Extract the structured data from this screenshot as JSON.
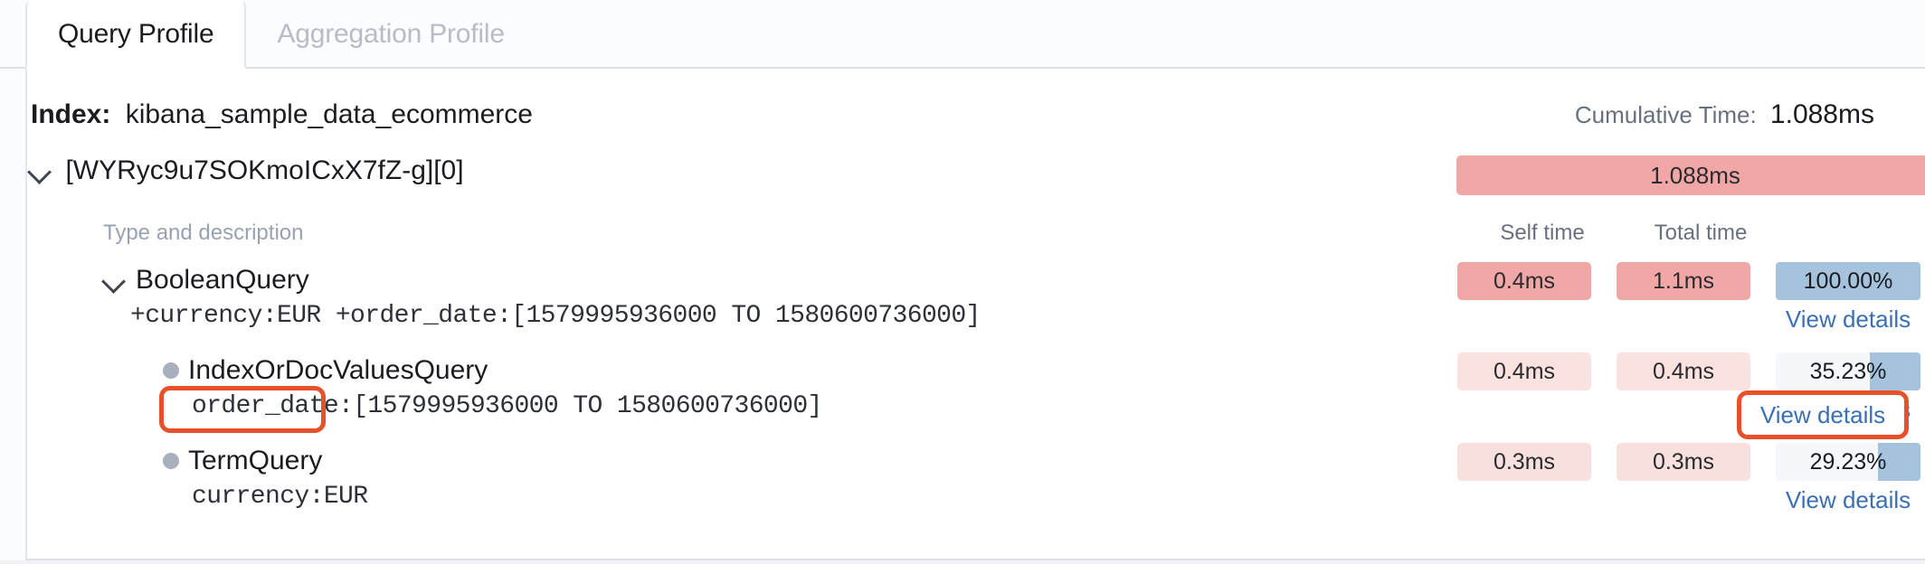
{
  "tabs": [
    {
      "label": "Query Profile",
      "active": true
    },
    {
      "label": "Aggregation Profile",
      "active": false
    }
  ],
  "header": {
    "index_label": "Index:",
    "index_value": "kibana_sample_data_ecommerce",
    "cumulative_label": "Cumulative Time:",
    "cumulative_value": "1.088ms"
  },
  "shard": {
    "id": "[WYRyc9u7SOKmoICxX7fZ-g][0]",
    "time": "1.088ms",
    "expanded": true
  },
  "columns": {
    "type_description": "Type and description",
    "self_time": "Self time",
    "total_time": "Total time"
  },
  "view_details_label": "View details",
  "rows": [
    {
      "name": "BooleanQuery",
      "description": "+currency:EUR +order_date:[1579995936000 TO 1580600736000]",
      "self_time": "0.4ms",
      "total_time": "1.1ms",
      "percent_label": "100.00%",
      "percent_value": 100.0,
      "self_color": "#f2a7a7",
      "total_color": "#f2a7a7",
      "marker": "chevron",
      "view_details": "View details"
    },
    {
      "name": "IndexOrDocValuesQuery",
      "description": "order_date:[1579995936000 TO 1580600736000]",
      "self_time": "0.4ms",
      "total_time": "0.4ms",
      "percent_label": "35.23%",
      "percent_value": 35.23,
      "self_color": "#fae2e0",
      "total_color": "#fae2e0",
      "marker": "bullet",
      "view_details": "View details"
    },
    {
      "name": "TermQuery",
      "description": "currency:EUR",
      "self_time": "0.3ms",
      "total_time": "0.3ms",
      "percent_label": "29.23%",
      "percent_value": 29.23,
      "self_color": "#f7e0dd",
      "total_color": "#f7e0dd",
      "marker": "bullet",
      "view_details": "View details"
    }
  ],
  "annotations": {
    "highlight_color": "#e8502a",
    "order_date_token": "order_date",
    "view_details_token": "View details"
  },
  "colors": {
    "bar_strong_pink": "#f2a7a7",
    "bar_light_pink": "#fae2e0",
    "pct_blue": "#a5c3dd",
    "pct_track": "#f6f7fb",
    "link_blue": "#3a6fb5"
  }
}
